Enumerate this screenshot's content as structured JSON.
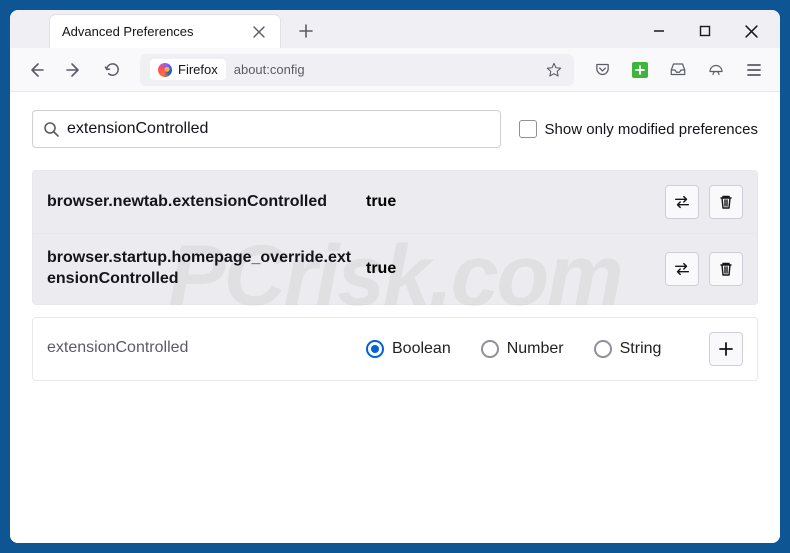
{
  "window": {
    "tab_title": "Advanced Preferences"
  },
  "addr": {
    "brand": "Firefox",
    "url": "about:config"
  },
  "search": {
    "value": "extensionControlled",
    "checkbox_label": "Show only modified preferences"
  },
  "prefs": [
    {
      "name": "browser.newtab.extensionControlled",
      "value": "true",
      "modified": true
    },
    {
      "name": "browser.startup.homepage_override.extensionControlled",
      "value": "true",
      "modified": true
    }
  ],
  "newpref": {
    "name": "extensionControlled",
    "types": {
      "boolean": "Boolean",
      "number": "Number",
      "string": "String"
    },
    "selected": "boolean"
  },
  "watermark": "PCrisk.com"
}
